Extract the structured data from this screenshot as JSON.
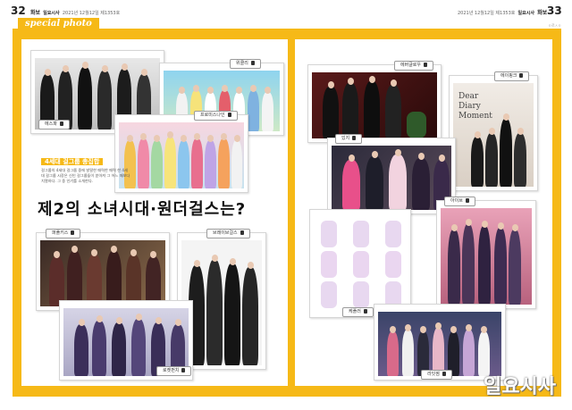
{
  "header": {
    "left_page_number": "32",
    "left_section": "화보",
    "left_publication": "일요시사",
    "left_issue": "2021년 12월12일 제1353호",
    "right_issue": "2021년 12월12일 제1353호",
    "right_publication": "일요시사",
    "right_section": "화보",
    "right_page_number": "33",
    "corner_note": "ㅇ르ㅅㅇ"
  },
  "spread": {
    "title": "special photo",
    "subhead": "4세대 걸그룹 총집합",
    "body": "걸그룹의 4세대 걸그룹 중에 발랄한 매력한 매력 한 4세대 걸그룹 시장은 신인 걸그룹들이 쏟아져 그 어느 때보다 치열하다. 그 중 인기를 소개한다.",
    "headline": "제2의 소녀시대·원더걸스는?",
    "watermark": "일요시사"
  },
  "photos": [
    {
      "id": "aespa",
      "tag": "에스파"
    },
    {
      "id": "weeekly",
      "tag": "위클리"
    },
    {
      "id": "fromis",
      "tag": "프로미스나인"
    },
    {
      "id": "purple",
      "tag": "퍼플키스"
    },
    {
      "id": "brave",
      "tag": "브레이브걸스"
    },
    {
      "id": "rocket",
      "tag": "로켓펀치"
    },
    {
      "id": "everglow",
      "tag": "에버글로우"
    },
    {
      "id": "apink",
      "tag": "에이핑크"
    },
    {
      "id": "itzy",
      "tag": "있지"
    },
    {
      "id": "kep1er",
      "tag": "케플러"
    },
    {
      "id": "ive",
      "tag": "아이브"
    },
    {
      "id": "lightsum",
      "tag": "라잇썸"
    },
    {
      "id": "stayc",
      "tag": "스테이씨"
    }
  ],
  "book_text": [
    "Dear",
    "Diary",
    "Moment"
  ],
  "colors": {
    "accent_yellow": "#f6b917",
    "frame_white": "#ffffff"
  }
}
